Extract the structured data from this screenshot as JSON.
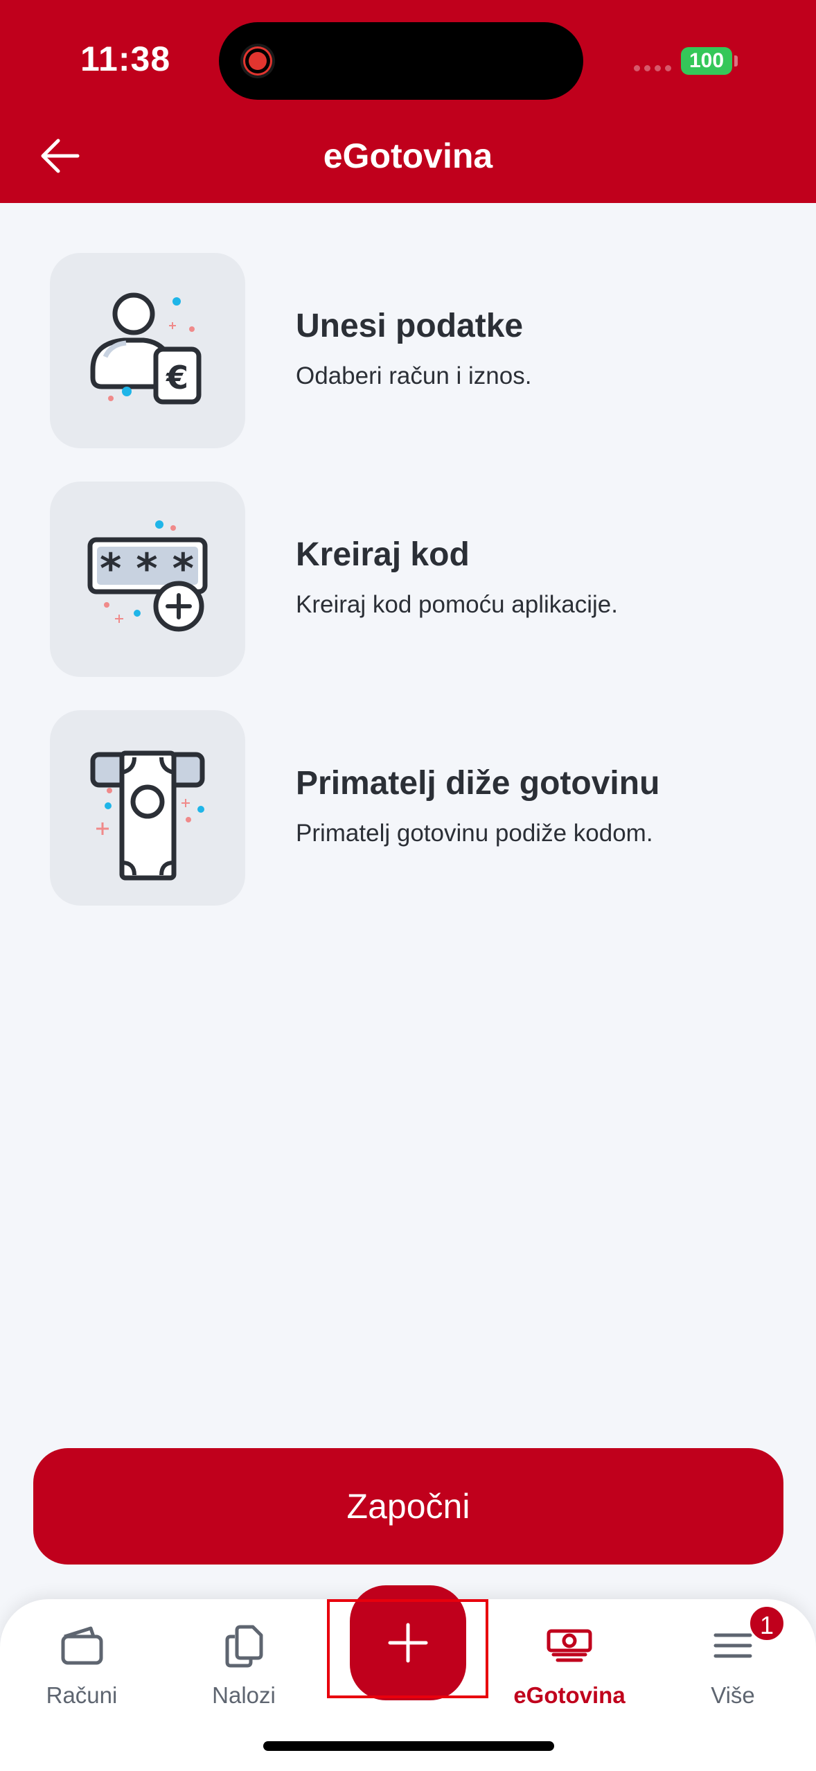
{
  "status_bar": {
    "time": "11:38",
    "battery": "100"
  },
  "header": {
    "title": "eGotovina",
    "back_icon": "arrow-left-icon"
  },
  "steps": [
    {
      "title": "Unesi podatke",
      "description": "Odaberi račun i iznos.",
      "icon": "person-euro-icon"
    },
    {
      "title": "Kreiraj kod",
      "description": "Kreiraj kod pomoću aplikacije.",
      "icon": "code-plus-icon"
    },
    {
      "title": "Primatelj diže gotovinu",
      "description": "Primatelj gotovinu podiže kodom.",
      "icon": "cash-withdraw-icon"
    }
  ],
  "start_button": {
    "label": "Započni"
  },
  "tabbar": {
    "items": [
      {
        "label": "Računi",
        "icon": "wallet-icon",
        "active": false
      },
      {
        "label": "Nalozi",
        "icon": "documents-icon",
        "active": false
      },
      {
        "label": "",
        "icon": "plus-icon",
        "active": false
      },
      {
        "label": "eGotovina",
        "icon": "banknote-icon",
        "active": true
      },
      {
        "label": "Više",
        "icon": "menu-icon",
        "active": false,
        "badge": "1"
      }
    ]
  },
  "colors": {
    "brand": "#c0001c",
    "background": "#f4f6fa",
    "icon_bg": "#e7eaef",
    "accent_blue": "#1fb5e8",
    "accent_pink": "#f08a8a"
  }
}
